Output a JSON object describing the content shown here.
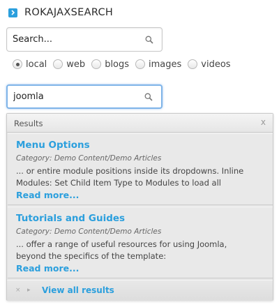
{
  "module": {
    "title": "ROKAJAXSEARCH",
    "accent_color": "#2b9fdd"
  },
  "search": {
    "placeholder": "Search...",
    "query_value": "joomla",
    "icon": "search-icon"
  },
  "filters": [
    {
      "label": "local",
      "selected": true
    },
    {
      "label": "web",
      "selected": false
    },
    {
      "label": "blogs",
      "selected": false
    },
    {
      "label": "images",
      "selected": false
    },
    {
      "label": "videos",
      "selected": false
    }
  ],
  "results_panel": {
    "header": "Results",
    "close_label": "x",
    "items": [
      {
        "title": "Menu Options",
        "category": "Category: Demo Content/Demo Articles",
        "snippet": "... or entire module positions inside its dropdowns. Inline Modules: Set Child Item Type to Modules to load all",
        "read_more": "Read more..."
      },
      {
        "title": "Tutorials and Guides",
        "category": "Category: Demo Content/Demo Articles",
        "snippet": "... offer a range of useful resources for using Joomla, beyond the specifics of the template:",
        "read_more": "Read more..."
      }
    ],
    "footer": {
      "prev_label": "×",
      "next_label": "▸",
      "view_all": "View all results"
    }
  }
}
